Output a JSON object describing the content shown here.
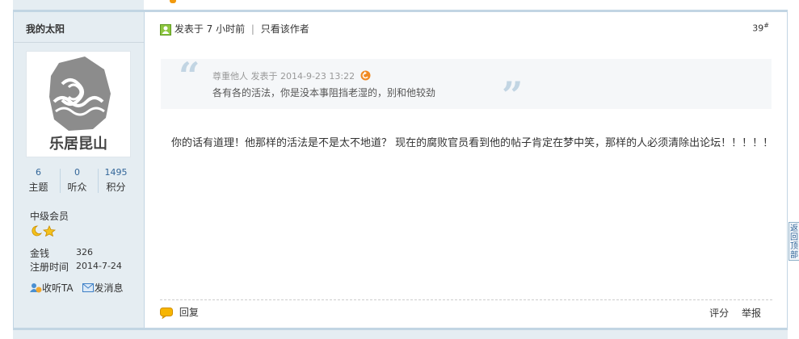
{
  "author": {
    "name": "我的太阳"
  },
  "avatar": {
    "caption": "乐居昆山"
  },
  "stats": [
    {
      "value": "6",
      "label": "主题"
    },
    {
      "value": "0",
      "label": "听众"
    },
    {
      "value": "1495",
      "label": "积分"
    }
  ],
  "profile": {
    "level": "中级会员",
    "money_label": "金钱",
    "money_value": "326",
    "reg_label": "注册时间",
    "reg_value": "2014-7-24"
  },
  "actions": {
    "follow": "收听TA",
    "message": "发消息"
  },
  "post": {
    "posted": "发表于 7 小时前",
    "only_author": "只看该作者",
    "floor": "39",
    "floor_sup": "#",
    "quote_meta": "尊重他人 发表于 2014-9-23 13:22",
    "quote_text": "各有各的活法，你是没本事阻挡老湿的，别和他较劲",
    "body": "你的话有道理！他那样的活法是不是太不地道？ 现在的腐败官员看到他的帖子肯定在梦中笑，那样的人必须清除出论坛！！！！！",
    "reply": "回复",
    "rate": "评分",
    "report": "举报"
  },
  "side": {
    "back_top": "返回顶部"
  }
}
